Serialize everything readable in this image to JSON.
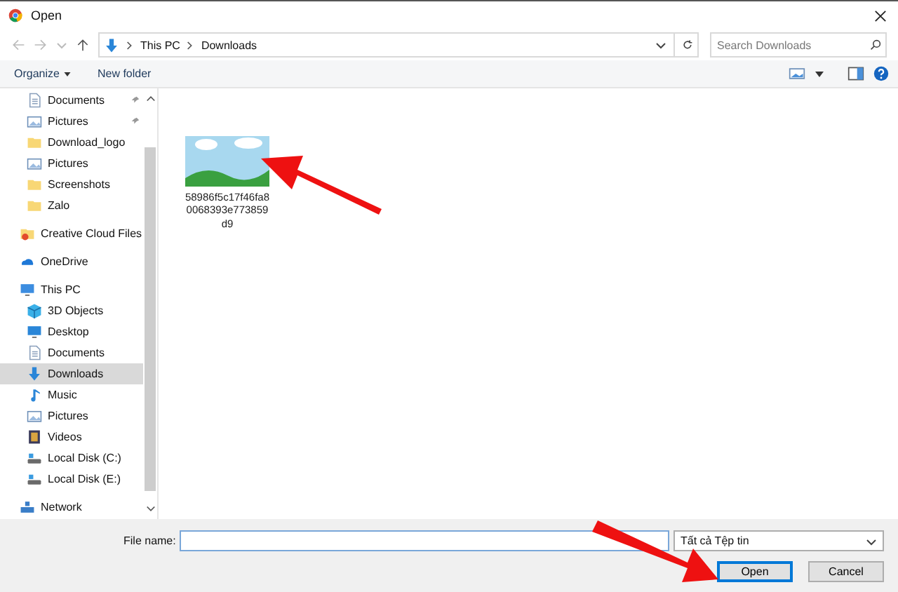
{
  "window": {
    "title": "Open"
  },
  "address_bar": {
    "path": [
      "This PC",
      "Downloads"
    ]
  },
  "search": {
    "placeholder": "Search Downloads"
  },
  "toolbar": {
    "buttons": [
      "Organize",
      "New folder"
    ]
  },
  "sidebar": {
    "pinned_items": [
      {
        "label": "Documents",
        "kind": "documents",
        "pinned": true,
        "selected": false
      },
      {
        "label": "Pictures",
        "kind": "pictures",
        "pinned": true,
        "selected": false
      },
      {
        "label": "Download_logo",
        "kind": "folder",
        "pinned": false,
        "selected": false
      },
      {
        "label": "Pictures",
        "kind": "pictures",
        "pinned": false,
        "selected": false
      },
      {
        "label": "Screenshots",
        "kind": "folder",
        "pinned": false,
        "selected": false
      },
      {
        "label": "Zalo",
        "kind": "folder",
        "pinned": false,
        "selected": false
      }
    ],
    "tree": [
      {
        "label": "Creative Cloud Files",
        "kind": "ccfolder",
        "selected": false
      },
      {
        "label": "OneDrive",
        "kind": "cloud",
        "selected": false
      },
      {
        "label": "This PC",
        "kind": "pc",
        "selected": false,
        "children": [
          {
            "label": "3D Objects",
            "kind": "objects3d",
            "selected": false
          },
          {
            "label": "Desktop",
            "kind": "desktop",
            "selected": false
          },
          {
            "label": "Documents",
            "kind": "documents",
            "selected": false
          },
          {
            "label": "Downloads",
            "kind": "downloads",
            "selected": true
          },
          {
            "label": "Music",
            "kind": "music",
            "selected": false
          },
          {
            "label": "Pictures",
            "kind": "pictures",
            "selected": false
          },
          {
            "label": "Videos",
            "kind": "videos",
            "selected": false
          },
          {
            "label": "Local Disk (C:)",
            "kind": "disk",
            "selected": false
          },
          {
            "label": "Local Disk (E:)",
            "kind": "disk",
            "selected": false
          }
        ]
      },
      {
        "label": "Network",
        "kind": "network",
        "selected": false
      }
    ]
  },
  "files": [
    {
      "name": "58986f5c17f46fa80068393e773859d9",
      "selected": false
    }
  ],
  "bottom": {
    "file_name_label": "File name:",
    "filter": "Tất cả Tệp tin",
    "buttons": [
      {
        "label": "Open",
        "default": true
      },
      {
        "label": "Cancel",
        "default": false
      }
    ]
  }
}
